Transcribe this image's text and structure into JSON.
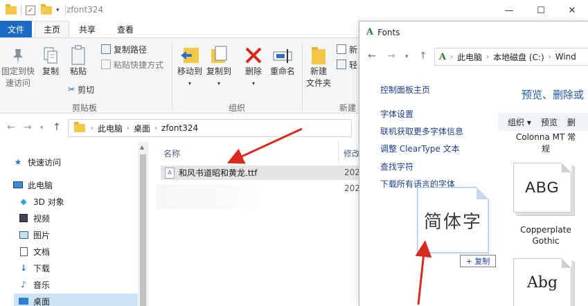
{
  "explorer": {
    "title": "zfont324",
    "menu": {
      "file": "文件",
      "home": "主页",
      "share": "共享",
      "view": "查看"
    },
    "window_controls": {
      "minimize": "—",
      "maximize": "☐",
      "close": "✕"
    },
    "ribbon": {
      "pin": "固定到快\n速访问",
      "copy": "复制",
      "paste": "粘贴",
      "copy_path": "复制路径",
      "paste_shortcut": "粘贴快捷方式",
      "cut": "剪切",
      "clipboard_group": "剪贴板",
      "move_to": "移动到",
      "copy_to": "复制到",
      "delete": "删除",
      "rename": "重命名",
      "organize_group": "组织",
      "new_folder": "新建\n文件夹",
      "new_item": "新",
      "easy_access": "轻",
      "new_group": "新建"
    },
    "address": {
      "crumbs": [
        "此电脑",
        "桌面",
        "zfont324"
      ]
    },
    "nav_items": [
      {
        "label": "快速访问",
        "icon": "star-icon"
      },
      {
        "label": "此电脑",
        "icon": "computer-icon"
      },
      {
        "label": "3D 对象",
        "icon": "cube-icon"
      },
      {
        "label": "视频",
        "icon": "video-icon"
      },
      {
        "label": "图片",
        "icon": "picture-icon"
      },
      {
        "label": "文档",
        "icon": "document-icon"
      },
      {
        "label": "下载",
        "icon": "download-icon"
      },
      {
        "label": "音乐",
        "icon": "music-icon"
      },
      {
        "label": "桌面",
        "icon": "desktop-icon"
      }
    ],
    "columns": {
      "name": "名称",
      "modified": "修改"
    },
    "files": [
      {
        "name": "和风书道昭和黄龙.ttf",
        "date": "202"
      }
    ],
    "extra_date": "202"
  },
  "fonts_window": {
    "title": "Fonts",
    "address": [
      "此电脑",
      "本地磁盘 (C:)",
      "Wind"
    ],
    "links": [
      "控制面板主页",
      "字体设置",
      "联机获取更多字体信息",
      "调整 ClearType 文本",
      "查找字符",
      "下载所有语言的字体"
    ],
    "heading": "预览、删除或",
    "toolbar": {
      "organize": "组织 ▾",
      "preview": "预览",
      "more": "删"
    },
    "fonts": [
      {
        "name": "Colonna MT 常\n规",
        "sample": ""
      },
      {
        "name": "Copperplate\nGothic",
        "sample": "ABG"
      },
      {
        "name": "",
        "sample": "Abg"
      }
    ],
    "drag_sample": "简体字",
    "copy_badge": "+ 复制"
  },
  "colors": {
    "accent": "#1b6bc6",
    "arrow": "#d92a1e",
    "link": "#1a3e8f",
    "heading": "#1e5aa8"
  }
}
